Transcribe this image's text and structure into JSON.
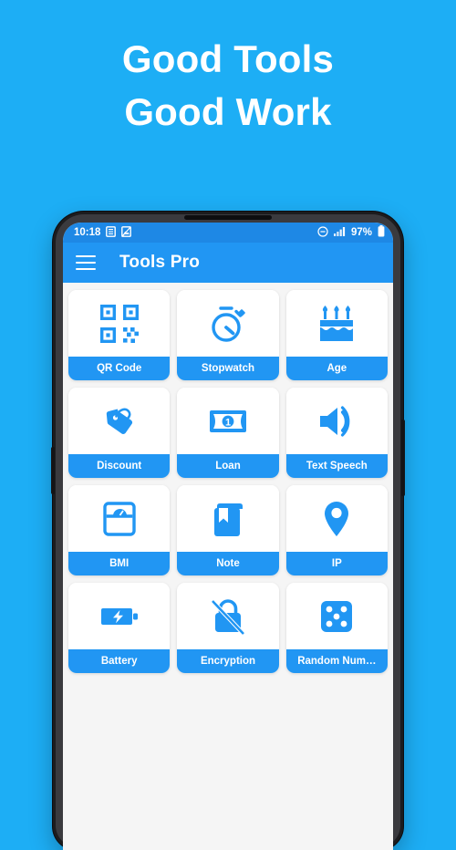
{
  "promo": {
    "line1": "Good Tools",
    "line2": "Good Work"
  },
  "phone": {
    "status_bar": {
      "time": "10:18",
      "icons_left": [
        "document-notification-icon",
        "image-notification-icon"
      ],
      "icons_right": [
        "do-not-disturb-icon",
        "signal-bars-icon"
      ],
      "battery_percent": "97%",
      "battery_icon": "battery-full-icon",
      "background_color": "#1E88E5"
    },
    "app_bar": {
      "menu_icon": "hamburger-menu-icon",
      "title": "Tools Pro",
      "background_color": "#2196F3"
    },
    "grid": {
      "accent_color": "#2196F3",
      "tiles": [
        {
          "label": "QR Code",
          "icon": "qr-code-icon"
        },
        {
          "label": "Stopwatch",
          "icon": "stopwatch-icon"
        },
        {
          "label": "Age",
          "icon": "birthday-cake-icon"
        },
        {
          "label": "Discount",
          "icon": "price-tag-icon"
        },
        {
          "label": "Loan",
          "icon": "banknote-icon"
        },
        {
          "label": "Text Speech",
          "icon": "speaker-volume-icon"
        },
        {
          "label": "BMI",
          "icon": "weight-scale-icon"
        },
        {
          "label": "Note",
          "icon": "bookmark-book-icon"
        },
        {
          "label": "IP",
          "icon": "location-pin-icon"
        },
        {
          "label": "Battery",
          "icon": "battery-charging-icon"
        },
        {
          "label": "Encryption",
          "icon": "lock-slash-icon"
        },
        {
          "label": "Random Num…",
          "icon": "dice-icon"
        }
      ]
    }
  },
  "colors": {
    "background": "#1DAEF5",
    "app_bar": "#2196F3",
    "status_bar": "#1E88E5",
    "tile_surface": "#FFFFFF",
    "screen_surface": "#F5F5F5"
  }
}
